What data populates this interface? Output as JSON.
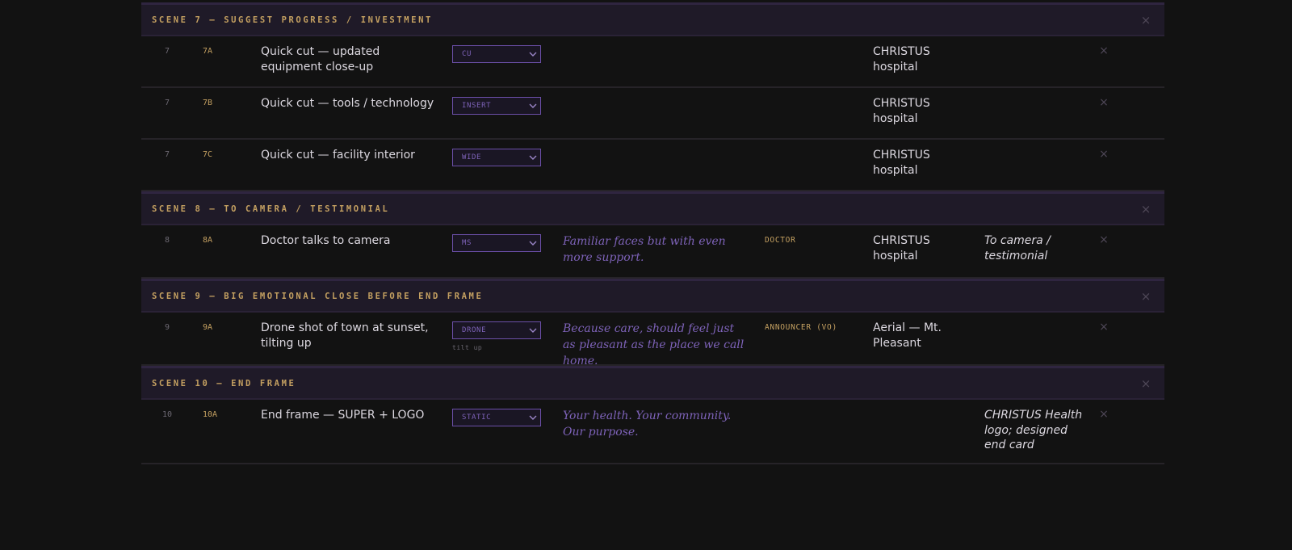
{
  "close_glyph": "×",
  "chevron_icon": "chevron-down-icon",
  "colors": {
    "background": "#121212",
    "scene_header_bg": "#1f1a28",
    "gold_accent": "#c4a061",
    "purple_accent": "#7d62b8",
    "text": "#dcd8e0"
  },
  "scenes": [
    {
      "title": "SCENE 7 — SUGGEST PROGRESS / INVESTMENT",
      "shots": [
        {
          "scene": "7",
          "shot": "7A",
          "description": "Quick cut — updated equipment close-up",
          "type": "CU",
          "type_note": "",
          "vo": "",
          "talent": "",
          "location": "CHRISTUS hospital",
          "notes": ""
        },
        {
          "scene": "7",
          "shot": "7B",
          "description": "Quick cut — tools / technology",
          "type": "INSERT",
          "type_note": "",
          "vo": "",
          "talent": "",
          "location": "CHRISTUS hospital",
          "notes": ""
        },
        {
          "scene": "7",
          "shot": "7C",
          "description": "Quick cut — facility interior",
          "type": "WIDE",
          "type_note": "",
          "vo": "",
          "talent": "",
          "location": "CHRISTUS hospital",
          "notes": ""
        }
      ]
    },
    {
      "title": "SCENE 8 — TO CAMERA / TESTIMONIAL",
      "shots": [
        {
          "scene": "8",
          "shot": "8A",
          "description": "Doctor talks to camera",
          "type": "MS",
          "type_note": "",
          "vo": "Familiar faces but with even more support.",
          "talent": "DOCTOR",
          "location": "CHRISTUS hospital",
          "notes": "To camera / testimonial"
        }
      ]
    },
    {
      "title": "SCENE 9 — BIG EMOTIONAL CLOSE BEFORE END FRAME",
      "shots": [
        {
          "scene": "9",
          "shot": "9A",
          "description": "Drone shot of town at sunset, tilting up",
          "type": "DRONE",
          "type_note": "tilt up",
          "vo": "Because care, should feel just as pleasant as the place we call home.",
          "talent": "ANNOUNCER (VO)",
          "location": "Aerial — Mt. Pleasant",
          "notes": ""
        }
      ]
    },
    {
      "title": "SCENE 10 — END FRAME",
      "shots": [
        {
          "scene": "10",
          "shot": "10A",
          "description": "End frame — SUPER + LOGO",
          "type": "STATIC",
          "type_note": "",
          "vo": "Your health. Your community. Our purpose.",
          "talent": "",
          "location": "",
          "notes": "CHRISTUS Health logo; designed end card"
        }
      ]
    }
  ]
}
